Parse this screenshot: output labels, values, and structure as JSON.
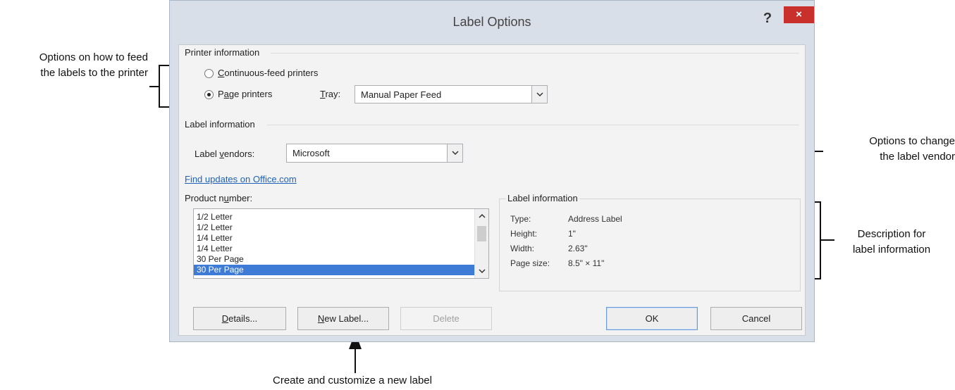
{
  "dialog": {
    "title": "Label Options",
    "help_label": "?",
    "close_label": "×"
  },
  "printer_info": {
    "heading": "Printer information",
    "continuous": {
      "pre": "",
      "accel": "C",
      "post": "ontinuous-feed printers",
      "checked": false
    },
    "page": {
      "pre": "P",
      "accel": "a",
      "post": "ge printers",
      "checked": true
    },
    "tray_label": {
      "accel": "T",
      "post": "ray:"
    },
    "tray_value": "Manual Paper Feed"
  },
  "label_info": {
    "heading": "Label information",
    "vendors_label": {
      "pre": "Label ",
      "accel": "v",
      "post": "endors:"
    },
    "vendors_value": "Microsoft",
    "find_updates": "Find updates on Office.com"
  },
  "product": {
    "label": {
      "pre": "Product n",
      "accel": "u",
      "post": "mber:"
    },
    "items": [
      "1/2 Letter",
      "1/2 Letter",
      "1/4 Letter",
      "1/4 Letter",
      "30 Per Page",
      "30 Per Page"
    ],
    "selected_index": 5
  },
  "label_details": {
    "heading": "Label information",
    "type_key": "Type:",
    "type_val": "Address Label",
    "height_key": "Height:",
    "height_val": "1\"",
    "width_key": "Width:",
    "width_val": "2.63\"",
    "pagesize_key": "Page size:",
    "pagesize_val": "8.5\" × 11\""
  },
  "buttons": {
    "details": {
      "accel": "D",
      "post": "etails..."
    },
    "new_label": {
      "accel": "N",
      "post": "ew Label..."
    },
    "delete": "Delete",
    "ok": "OK",
    "cancel": "Cancel"
  },
  "callouts": {
    "feed_line1": "Options on how to feed",
    "feed_line2": "the labels to the printer",
    "vendor_line1": "Options to change",
    "vendor_line2": "the label vendor",
    "desc_line1": "Description for",
    "desc_line2": "label information",
    "new_label": "Create and customize a new label"
  },
  "icons": {
    "dropdown": "chevron-down-icon",
    "scroll_up": "chevron-up-icon",
    "scroll_down": "chevron-down-icon",
    "close": "close-icon",
    "help": "help-icon"
  },
  "colors": {
    "close_button": "#c9302c",
    "selection": "#3e7bd6",
    "link": "#1e62b8"
  }
}
